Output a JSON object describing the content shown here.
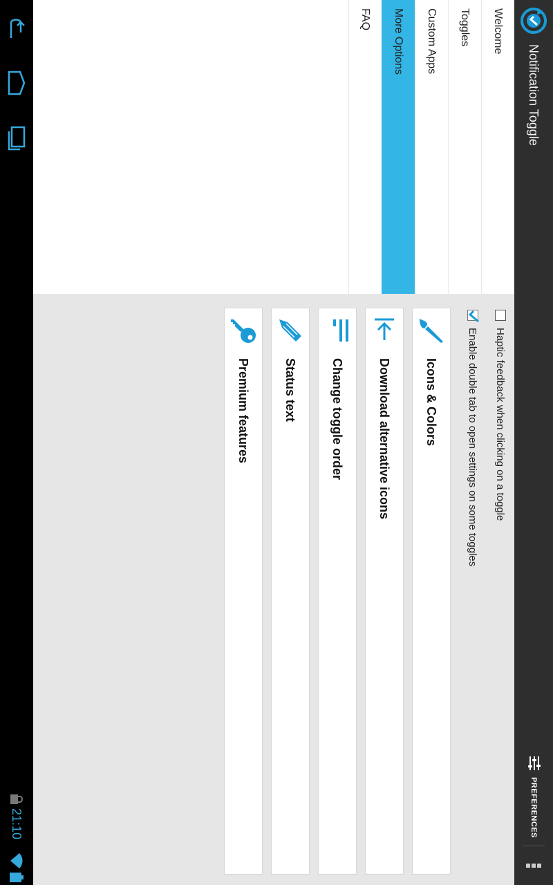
{
  "app": {
    "title": "Notification Toggle",
    "preferences_label": "PREFERENCES"
  },
  "nav": {
    "items": [
      {
        "label": "Welcome",
        "selected": false
      },
      {
        "label": "Toggles",
        "selected": false
      },
      {
        "label": "Custom Apps",
        "selected": false
      },
      {
        "label": "More Options",
        "selected": true
      },
      {
        "label": "FAQ",
        "selected": false
      }
    ]
  },
  "settings": {
    "haptic": {
      "label": "Haptic feedback when clicking on a toggle",
      "checked": false
    },
    "double_tap": {
      "label": "Enable double tab to open settings on some toggles",
      "checked": true
    }
  },
  "cards": [
    {
      "label": "Icons & Colors",
      "icon": "paintbrush-icon"
    },
    {
      "label": "Download alternative icons",
      "icon": "download-icon"
    },
    {
      "label": "Change toggle order",
      "icon": "order-icon"
    },
    {
      "label": "Status text",
      "icon": "pencil-icon"
    },
    {
      "label": "Premium features",
      "icon": "key-icon"
    }
  ],
  "status_bar": {
    "time": "21:10"
  },
  "colors": {
    "accent": "#33b5e5",
    "icon_blue": "#1a9ad6",
    "action_bar": "#2e2e2e",
    "background": "#e6e6e6"
  }
}
